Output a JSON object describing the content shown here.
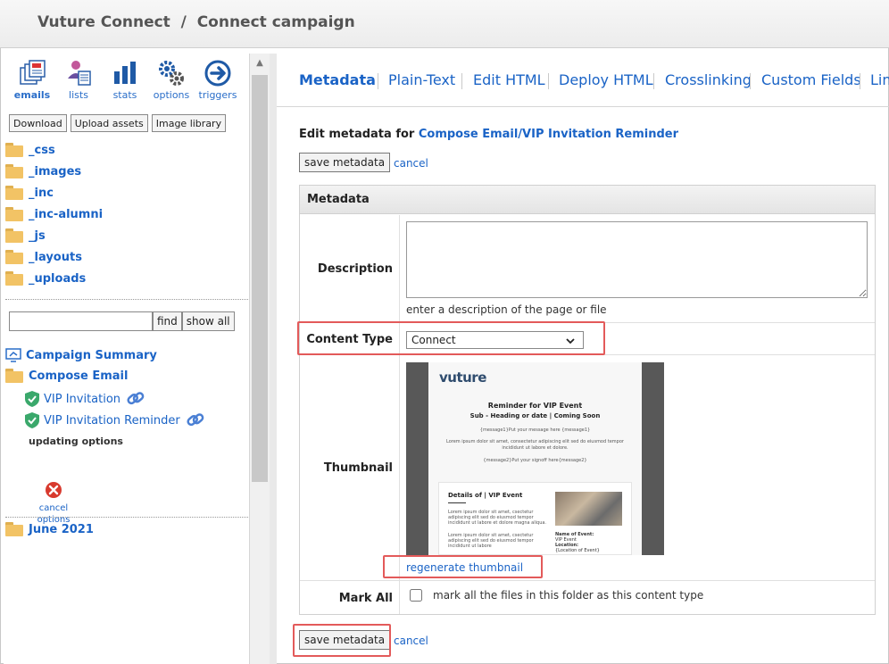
{
  "header": {
    "title": "Vuture Connect  /  Connect campaign"
  },
  "toolbar": {
    "tools": [
      {
        "label": "emails",
        "icon": "emails-icon"
      },
      {
        "label": "lists",
        "icon": "lists-icon"
      },
      {
        "label": "stats",
        "icon": "stats-icon"
      },
      {
        "label": "options",
        "icon": "gears-icon"
      },
      {
        "label": "triggers",
        "icon": "arrow-circle-icon"
      }
    ],
    "buttons": {
      "download": "Download",
      "upload": "Upload assets",
      "library": "Image library"
    }
  },
  "folders": [
    "_css",
    "_images",
    "_inc",
    "_inc-alumni",
    "_js",
    "_layouts",
    "_uploads"
  ],
  "search": {
    "value": "",
    "find_label": "find",
    "show_all_label": "show all"
  },
  "tree": {
    "campaign_summary": "Campaign Summary",
    "compose_email": "Compose Email",
    "vip_invitation": "VIP Invitation",
    "vip_reminder": "VIP Invitation Reminder",
    "status": "updating options",
    "cancel_options": "cancel options",
    "june": "June 2021"
  },
  "tabs": [
    "Metadata",
    "Plain-Text",
    "Edit HTML",
    "Deploy HTML",
    "Crosslinking",
    "Custom Fields",
    "Lin"
  ],
  "editor": {
    "intro": "Edit metadata for",
    "target": "Compose Email/VIP Invitation Reminder",
    "save_label": "save metadata",
    "cancel_label": "cancel",
    "section_title": "Metadata",
    "description_label": "Description",
    "description_value": "",
    "description_hint": "enter a description of the page or file",
    "content_type_label": "Content Type",
    "content_type_value": "Connect",
    "thumbnail_label": "Thumbnail",
    "regen_label": "regenerate thumbnail",
    "mark_all_label": "Mark All",
    "mark_all_text": "mark all the files in this folder as this content type"
  },
  "thumbnail": {
    "brand": "vuture",
    "title": "Reminder for VIP Event",
    "subtitle": "Sub - Heading or date | Coming Soon",
    "message1": "{message1}Put your message here {message1}",
    "lorem": "Lorem ipsum dolor sit amet, consectetur adipiscing elit sed do eiusmod tempor incididunt ut labore et dolore.",
    "message2": "{message2}Put your signoff here{message2}",
    "card_title": "Details of | VIP Event",
    "card_lorem1": "Lorem ipsum dolor sit amet, csectetur adipiscing elit sed do eiusmod tempor incididunt ut labore et dolore magna aliqua.",
    "card_lorem2": "Lorem ipsum dolor sit amet, csectetur adipiscing elit sed do eiusmod tempor incididunt ut labore",
    "name_label": "Name of Event:",
    "name_value": "VIP Event",
    "location_label": "Location:",
    "location_value": "{Location of Event}"
  },
  "colors": {
    "link": "#1a63c6",
    "highlight": "#e35a5a"
  }
}
